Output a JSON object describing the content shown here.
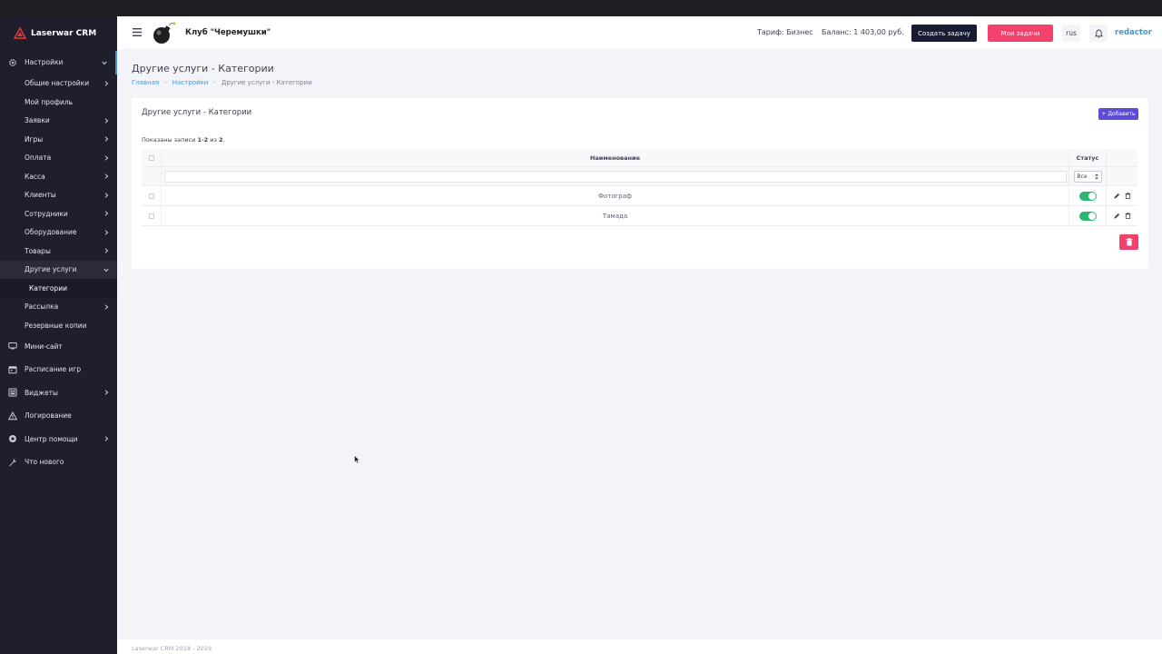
{
  "brand": {
    "name": "Laserwar CRM"
  },
  "sidebar": {
    "sections": [
      {
        "label": "Настройки",
        "icon": "gear-icon",
        "expanded": true
      },
      {
        "label": "Общие настройки",
        "sub": true,
        "chevron": true
      },
      {
        "label": "Мой профиль",
        "sub": true,
        "chevron": false
      },
      {
        "label": "Заявки",
        "sub": true,
        "chevron": true
      },
      {
        "label": "Игры",
        "sub": true,
        "chevron": true
      },
      {
        "label": "Оплата",
        "sub": true,
        "chevron": true
      },
      {
        "label": "Касса",
        "sub": true,
        "chevron": true
      },
      {
        "label": "Клиенты",
        "sub": true,
        "chevron": true
      },
      {
        "label": "Сотрудники",
        "sub": true,
        "chevron": true
      },
      {
        "label": "Оборудование",
        "sub": true,
        "chevron": true
      },
      {
        "label": "Товары",
        "sub": true,
        "chevron": true
      },
      {
        "label": "Другие услуги",
        "sub": true,
        "expanded": true
      },
      {
        "label": "Категории",
        "leaf": true
      },
      {
        "label": "Рассылка",
        "sub": true,
        "chevron": true
      },
      {
        "label": "Резервные копии",
        "sub": true,
        "chevron": false
      },
      {
        "label": "Мини-сайт",
        "icon": "monitor-icon"
      },
      {
        "label": "Расписание игр",
        "icon": "calendar-icon"
      },
      {
        "label": "Виджеты",
        "icon": "widgets-icon",
        "chevron": true
      },
      {
        "label": "Логирование",
        "icon": "warning-icon"
      },
      {
        "label": "Центр помощи",
        "icon": "help-icon",
        "chevron": true
      },
      {
        "label": "Что нового",
        "icon": "wrench-icon"
      }
    ]
  },
  "header": {
    "club_name": "Клуб \"Черемушки\"",
    "tariff": "Тариф: Бизнес",
    "balance": "Баланс: 1 403,00 руб.",
    "create_task": "Создать задачу",
    "my_tasks": "Мои задачи",
    "lang": "rus",
    "user": "redactor"
  },
  "page": {
    "title": "Другие услуги - Категории",
    "breadcrumb": [
      "Главная",
      "Настройки",
      "Другие услуги - Категории"
    ]
  },
  "card": {
    "title": "Другие услуги - Категории",
    "add_label": "+ Добавить",
    "summary_prefix": "Показаны записи ",
    "summary_range": "1-2",
    "summary_mid": " из ",
    "summary_total": "2",
    "summary_suffix": ".",
    "columns": {
      "name": "Наименование",
      "status": "Статус"
    },
    "filter_status": "Все",
    "rows": [
      {
        "name": "Фотограф",
        "status_on": true
      },
      {
        "name": "Тамада",
        "status_on": true
      }
    ]
  },
  "footer": {
    "text": "Laserwar CRM 2018 - 2019"
  },
  "colors": {
    "sidebar": "#1e1e2d",
    "accent_blue": "#3e97d1",
    "danger": "#f1416c",
    "primary": "#5b4bd6",
    "toggle_on": "#2bb673"
  }
}
